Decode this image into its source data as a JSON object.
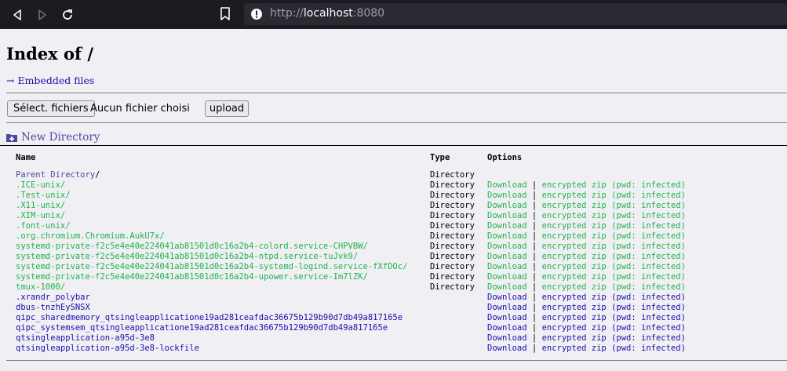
{
  "browser": {
    "url_scheme": "http://",
    "url_host": "localhost",
    "url_port": ":8080"
  },
  "page": {
    "title": "Index of /",
    "embedded_link": "→ Embedded files",
    "file_button": "Sélect. fichiers",
    "no_file": "Aucun fichier choisi",
    "upload": "upload",
    "new_directory": "New Directory"
  },
  "table": {
    "headers": {
      "name": "Name",
      "type": "Type",
      "options": "Options"
    },
    "parent": {
      "name": "Parent Directory",
      "suffix": "/",
      "type": "Directory"
    },
    "download_label": "Download",
    "separator": "|",
    "zip_label": "encrypted zip (pwd: infected)",
    "rows": [
      {
        "name": ".ICE-unix/",
        "type": "Directory",
        "kind": "dir"
      },
      {
        "name": ".Test-unix/",
        "type": "Directory",
        "kind": "dir"
      },
      {
        "name": ".X11-unix/",
        "type": "Directory",
        "kind": "dir"
      },
      {
        "name": ".XIM-unix/",
        "type": "Directory",
        "kind": "dir"
      },
      {
        "name": ".font-unix/",
        "type": "Directory",
        "kind": "dir"
      },
      {
        "name": ".org.chromium.Chromium.AukU7x/",
        "type": "Directory",
        "kind": "dir"
      },
      {
        "name": "systemd-private-f2c5e4e40e224041ab81501d0c16a2b4-colord.service-CHPVBW/",
        "type": "Directory",
        "kind": "dir"
      },
      {
        "name": "systemd-private-f2c5e4e40e224041ab81501d0c16a2b4-ntpd.service-tuJvk9/",
        "type": "Directory",
        "kind": "dir"
      },
      {
        "name": "systemd-private-f2c5e4e40e224041ab81501d0c16a2b4-systemd-logind.service-fXfDOc/",
        "type": "Directory",
        "kind": "dir"
      },
      {
        "name": "systemd-private-f2c5e4e40e224041ab81501d0c16a2b4-upower.service-Im7lZK/",
        "type": "Directory",
        "kind": "dir"
      },
      {
        "name": "tmux-1000/",
        "type": "Directory",
        "kind": "dir"
      },
      {
        "name": ".xrandr_polybar",
        "type": "",
        "kind": "file"
      },
      {
        "name": "dbus-tnzhEySNSX",
        "type": "",
        "kind": "file"
      },
      {
        "name": "qipc_sharedmemory_qtsingleapplicatione19ad281ceafdac36675b129b90d7db49a817165e",
        "type": "",
        "kind": "file"
      },
      {
        "name": "qipc_systemsem_qtsingleapplicatione19ad281ceafdac36675b129b90d7db49a817165e",
        "type": "",
        "kind": "file"
      },
      {
        "name": "qtsingleapplication-a95d-3e8",
        "type": "",
        "kind": "file"
      },
      {
        "name": "qtsingleapplication-a95d-3e8-lockfile",
        "type": "",
        "kind": "file"
      }
    ]
  },
  "colors": {
    "directory_link": "#1eb34a",
    "file_link": "#1a0dab",
    "chrome_bg": "#1c1b22",
    "page_bg": "#f0f0f4"
  }
}
